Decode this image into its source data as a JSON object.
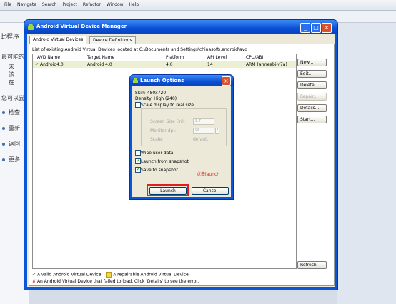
{
  "eclipse": {
    "menu": [
      "File",
      "Navigate",
      "Search",
      "Project",
      "Refactor",
      "Window",
      "Help"
    ],
    "left_texts": [
      "此程序",
      "最可能的原",
      "未",
      "该",
      "在",
      "您可以尝试",
      "检查",
      "重新",
      "返回",
      "更多"
    ]
  },
  "avd_window": {
    "title": "Android Virtual Device Manager",
    "tabs": [
      "Android Virtual Devices",
      "Device Definitions"
    ],
    "caption": "List of existing Android Virtual Devices located at C:\\Documents and Settings\\chinasoft\\.android\\avd",
    "columns": [
      "AVD Name",
      "Target Name",
      "Platform",
      "API Level",
      "CPU/ABI"
    ],
    "rows": [
      {
        "name": "Android4.0",
        "target": "Android 4.0",
        "platform": "4.0",
        "api": "14",
        "cpu": "ARM (armeabi-v7a)"
      }
    ],
    "buttons": [
      "New...",
      "Edit...",
      "Delete...",
      "Repair...",
      "Details...",
      "Start..."
    ],
    "refresh": "Refresh",
    "legend_valid": "A valid Android Virtual Device.",
    "legend_repairable": "A repairable Android Virtual Device.",
    "legend_failed": "An Android Virtual Device that failed to load. Click 'Details' to see the error."
  },
  "launch": {
    "title": "Launch Options",
    "skin": "Skin:   480x720",
    "density": "Density: High (240)",
    "scale_label": "Scale display to real size",
    "screen_size_label": "Screen Size (in):",
    "screen_size_value": "3.7",
    "monitor_dpi_label": "Monitor dpi:",
    "monitor_dpi_value": "96",
    "scale_label2": "Scale:",
    "scale_value": "default",
    "wipe_label": "Wipe user data",
    "launch_snapshot_label": "Launch from snapshot",
    "save_snapshot_label": "Save to snapshot",
    "annotation": "点击launch",
    "launch_button": "Launch",
    "cancel_button": "Cancel"
  },
  "colors": {
    "title_blue": "#0a4fd2",
    "annotation_red": "#e02020",
    "row_highlight": "#ecefd2"
  }
}
